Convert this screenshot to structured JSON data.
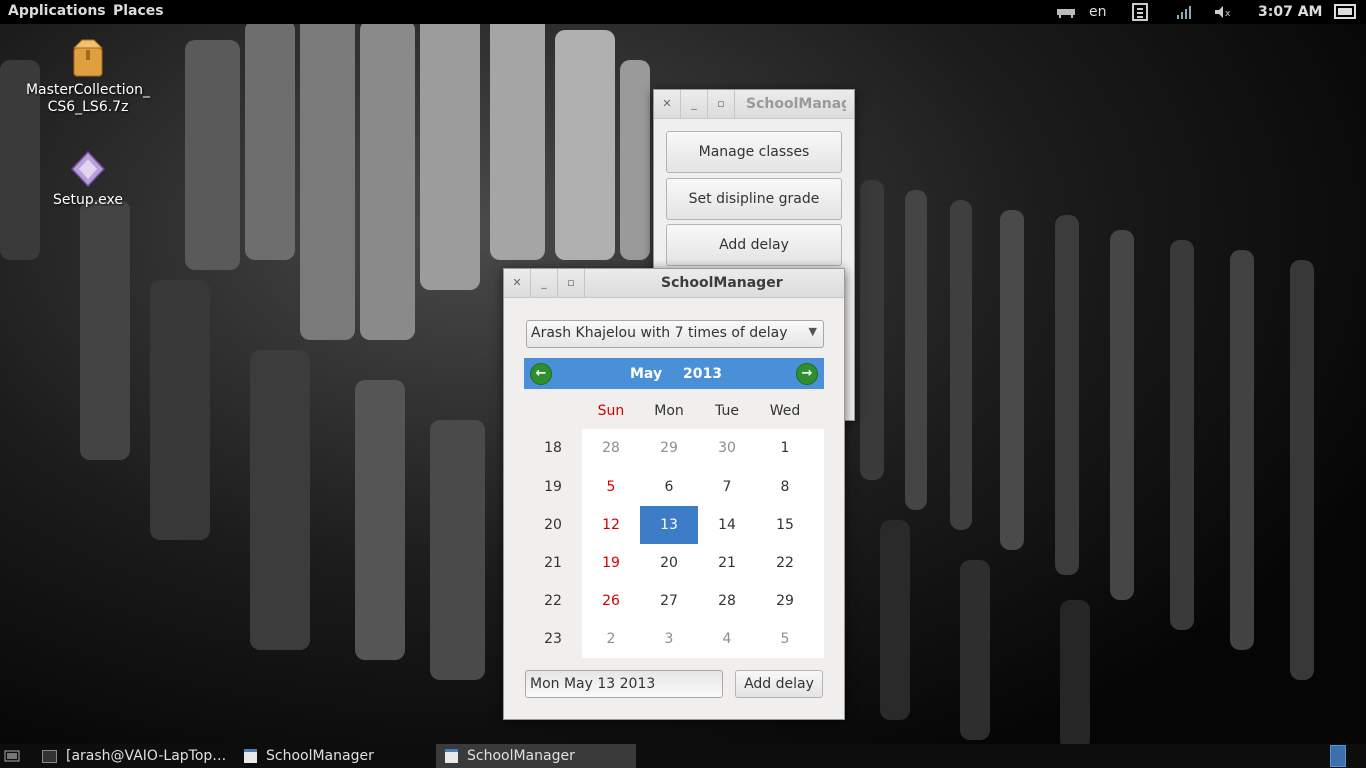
{
  "top_panel": {
    "applications": "Applications",
    "places": "Places",
    "keyboard_layout": "en",
    "clock": "3:07 AM"
  },
  "desktop": {
    "icons": [
      {
        "label_line1": "MasterCollection_",
        "label_line2": "CS6_LS6.7z",
        "icon": "archive-icon"
      },
      {
        "label": "Setup.exe",
        "icon": "executable-icon"
      }
    ]
  },
  "main_window": {
    "title": "SchoolManager",
    "buttons": [
      "Manage classes",
      "Set disipline grade",
      "Add delay"
    ]
  },
  "dialog": {
    "title": "SchoolManager",
    "student_select": "Arash Khajelou with 7 times of delay",
    "calendar": {
      "month": "May",
      "year": "2013",
      "day_names": [
        "Sun",
        "Mon",
        "Tue",
        "Wed"
      ],
      "week_numbers": [
        "18",
        "19",
        "20",
        "21",
        "22",
        "23"
      ],
      "rows": [
        [
          "28",
          "29",
          "30",
          "1"
        ],
        [
          "5",
          "6",
          "7",
          "8"
        ],
        [
          "12",
          "13",
          "14",
          "15"
        ],
        [
          "19",
          "20",
          "21",
          "22"
        ],
        [
          "26",
          "27",
          "28",
          "29"
        ],
        [
          "2",
          "3",
          "4",
          "5"
        ]
      ],
      "selected_day": "13"
    },
    "date_field": "Mon May 13 2013",
    "add_button": "Add delay"
  },
  "taskbar": {
    "items": [
      "[arash@VAIO-LapTop…",
      "SchoolManager",
      "SchoolManager"
    ],
    "active_index": 2
  },
  "colors": {
    "calendar_header": "#4a90d9",
    "selected_day": "#3d7cc7",
    "sunday": "#d40000"
  }
}
